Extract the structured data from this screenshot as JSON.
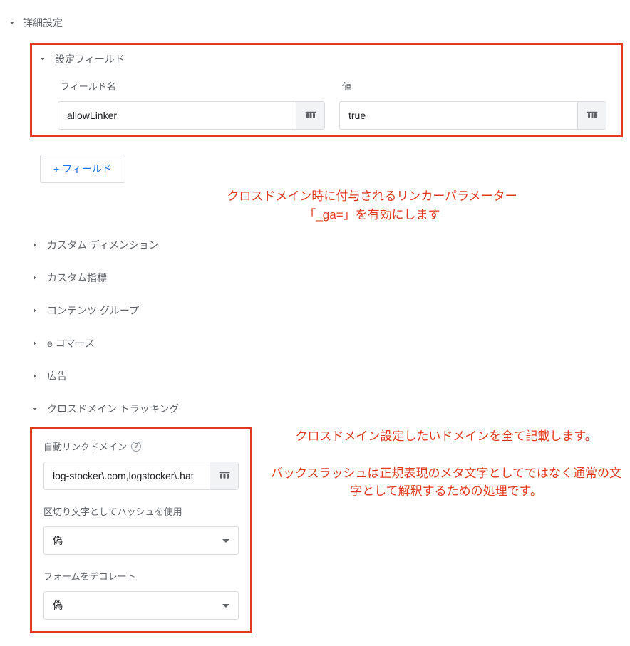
{
  "top": {
    "label": "詳細設定"
  },
  "settings_fields": {
    "title": "設定フィールド",
    "fieldname_label": "フィールド名",
    "value_label": "値",
    "fieldname_value": "allowLinker",
    "value_value": "true",
    "add_button": "+ フィールド",
    "remove_button": "-"
  },
  "annotation1_line1": "クロスドメイン時に付与されるリンカーパラメーター",
  "annotation1_line2": "「_ga=」を有効にします",
  "sections": {
    "custom_dimensions": "カスタム ディメンション",
    "custom_metrics": "カスタム指標",
    "content_groups": "コンテンツ グループ",
    "ecommerce": "e コマース",
    "ads": "広告",
    "crossdomain": "クロスドメイン トラッキング"
  },
  "crossdomain": {
    "autolink_label": "自動リンクドメイン",
    "autolink_value": "log-stocker\\.com,logstocker\\.hat",
    "hash_label": "区切り文字としてハッシュを使用",
    "hash_value": "偽",
    "decorate_label": "フォームをデコレート",
    "decorate_value": "偽"
  },
  "annotation2_p1": "クロスドメイン設定したいドメインを全て記載します。",
  "annotation2_p2": "バックスラッシュは正規表現のメタ文字としてではなく通常の文字として解釈するための処理です。"
}
